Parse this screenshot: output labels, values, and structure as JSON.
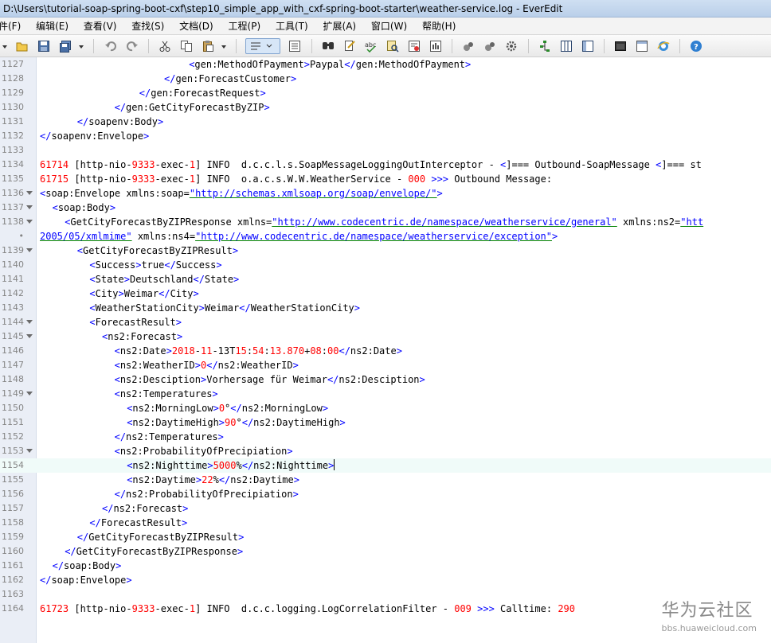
{
  "window": {
    "title": "D:\\Users\\tutorial-soap-spring-boot-cxf\\step10_simple_app_with_cxf-spring-boot-starter\\weather-service.log - EverEdit"
  },
  "menu": [
    "件(F)",
    "编辑(E)",
    "查看(V)",
    "查找(S)",
    "文档(D)",
    "工程(P)",
    "工具(T)",
    "扩展(A)",
    "窗口(W)",
    "帮助(H)"
  ],
  "toolbar": {
    "icons": [
      "open-icon",
      "save-icon",
      "save-all-icon",
      "dropdown-icon",
      "undo-icon",
      "redo-icon",
      "cut-icon",
      "copy-icon",
      "paste-icon",
      "dropdown-icon",
      "word-wrap-icon",
      "indent-icon",
      "find-icon",
      "replace-icon",
      "spell-check-icon",
      "find-in-files-icon",
      "mark-icon",
      "macro-record-icon",
      "macro-play-icon",
      "settings-icon",
      "tree-icon",
      "column-icon",
      "split-icon",
      "terminal-icon",
      "browser-icon",
      "ie-icon",
      "help-icon"
    ]
  },
  "editor": {
    "current_line": "1154",
    "lines": [
      {
        "n": "1127",
        "fold": false,
        "indent": 12,
        "parts": [
          [
            "tag",
            "<"
          ],
          [
            "name",
            "gen:MethodOfPayment"
          ],
          [
            "tag",
            ">"
          ],
          [
            "plain",
            "Paypal"
          ],
          [
            "tag",
            "</"
          ],
          [
            "name",
            "gen:MethodOfPayment"
          ],
          [
            "tag",
            ">"
          ]
        ]
      },
      {
        "n": "1128",
        "fold": false,
        "indent": 10,
        "parts": [
          [
            "tag",
            "</"
          ],
          [
            "name",
            "gen:ForecastCustomer"
          ],
          [
            "tag",
            ">"
          ]
        ]
      },
      {
        "n": "1129",
        "fold": false,
        "indent": 8,
        "parts": [
          [
            "tag",
            "</"
          ],
          [
            "name",
            "gen:ForecastRequest"
          ],
          [
            "tag",
            ">"
          ]
        ]
      },
      {
        "n": "1130",
        "fold": false,
        "indent": 6,
        "parts": [
          [
            "tag",
            "</"
          ],
          [
            "name",
            "gen:GetCityForecastByZIP"
          ],
          [
            "tag",
            ">"
          ]
        ]
      },
      {
        "n": "1131",
        "fold": false,
        "indent": 3,
        "parts": [
          [
            "tag",
            "</"
          ],
          [
            "name",
            "soapenv:Body"
          ],
          [
            "tag",
            ">"
          ]
        ]
      },
      {
        "n": "1132",
        "fold": false,
        "indent": 0,
        "parts": [
          [
            "tag",
            "</"
          ],
          [
            "name",
            "soapenv:Envelope"
          ],
          [
            "tag",
            ">"
          ]
        ]
      },
      {
        "n": "1133",
        "fold": false,
        "indent": 0,
        "parts": []
      },
      {
        "n": "1134",
        "fold": false,
        "indent": 0,
        "parts": [
          [
            "red",
            "61714"
          ],
          [
            "plain",
            " [http-nio-"
          ],
          [
            "red",
            "9333"
          ],
          [
            "plain",
            "-exec-"
          ],
          [
            "red",
            "1"
          ],
          [
            "plain",
            "] INFO  d.c.c.l.s.SoapMessageLoggingOutInterceptor - "
          ],
          [
            "tag",
            "<"
          ],
          [
            "plain",
            "]=== Outbound-SoapMessage "
          ],
          [
            "tag",
            "<"
          ],
          [
            "plain",
            "]=== st"
          ]
        ]
      },
      {
        "n": "1135",
        "fold": false,
        "indent": 0,
        "parts": [
          [
            "red",
            "61715"
          ],
          [
            "plain",
            " [http-nio-"
          ],
          [
            "red",
            "9333"
          ],
          [
            "plain",
            "-exec-"
          ],
          [
            "red",
            "1"
          ],
          [
            "plain",
            "] INFO  o.a.c.s.W.W.WeatherService - "
          ],
          [
            "red",
            "000"
          ],
          [
            "plain",
            " "
          ],
          [
            "tag",
            ">>>"
          ],
          [
            "plain",
            " Outbound Message:"
          ]
        ]
      },
      {
        "n": "1136",
        "fold": true,
        "indent": 0,
        "parts": [
          [
            "tag",
            "<"
          ],
          [
            "name",
            "soap:Envelope xmlns:soap="
          ],
          [
            "str",
            "\"http://schemas.xmlsoap.org/soap/envelope/\""
          ],
          [
            "tag",
            ">"
          ]
        ]
      },
      {
        "n": "1137",
        "fold": true,
        "indent": 1,
        "parts": [
          [
            "tag",
            "<"
          ],
          [
            "name",
            "soap:Body"
          ],
          [
            "tag",
            ">"
          ]
        ]
      },
      {
        "n": "1138",
        "fold": true,
        "indent": 2,
        "parts": [
          [
            "tag",
            "<"
          ],
          [
            "name",
            "GetCityForecastByZIPResponse xmlns="
          ],
          [
            "str",
            "\"http://www.codecentric.de/namespace/weatherservice/general\""
          ],
          [
            "plain",
            " xmlns:ns2="
          ],
          [
            "str",
            "\"htt"
          ]
        ]
      },
      {
        "n": "•",
        "fold": false,
        "indent": 0,
        "parts": [
          [
            "str",
            "2005/05/xmlmime\""
          ],
          [
            "plain",
            " xmlns:ns4="
          ],
          [
            "str",
            "\"http://www.codecentric.de/namespace/weatherservice/exception\""
          ],
          [
            "tag",
            ">"
          ]
        ]
      },
      {
        "n": "1139",
        "fold": true,
        "indent": 3,
        "parts": [
          [
            "tag",
            "<"
          ],
          [
            "name",
            "GetCityForecastByZIPResult"
          ],
          [
            "tag",
            ">"
          ]
        ]
      },
      {
        "n": "1140",
        "fold": false,
        "indent": 4,
        "parts": [
          [
            "tag",
            "<"
          ],
          [
            "name",
            "Success"
          ],
          [
            "tag",
            ">"
          ],
          [
            "plain",
            "true"
          ],
          [
            "tag",
            "</"
          ],
          [
            "name",
            "Success"
          ],
          [
            "tag",
            ">"
          ]
        ]
      },
      {
        "n": "1141",
        "fold": false,
        "indent": 4,
        "parts": [
          [
            "tag",
            "<"
          ],
          [
            "name",
            "State"
          ],
          [
            "tag",
            ">"
          ],
          [
            "plain",
            "Deutschland"
          ],
          [
            "tag",
            "</"
          ],
          [
            "name",
            "State"
          ],
          [
            "tag",
            ">"
          ]
        ]
      },
      {
        "n": "1142",
        "fold": false,
        "indent": 4,
        "parts": [
          [
            "tag",
            "<"
          ],
          [
            "name",
            "City"
          ],
          [
            "tag",
            ">"
          ],
          [
            "plain",
            "Weimar"
          ],
          [
            "tag",
            "</"
          ],
          [
            "name",
            "City"
          ],
          [
            "tag",
            ">"
          ]
        ]
      },
      {
        "n": "1143",
        "fold": false,
        "indent": 4,
        "parts": [
          [
            "tag",
            "<"
          ],
          [
            "name",
            "WeatherStationCity"
          ],
          [
            "tag",
            ">"
          ],
          [
            "plain",
            "Weimar"
          ],
          [
            "tag",
            "</"
          ],
          [
            "name",
            "WeatherStationCity"
          ],
          [
            "tag",
            ">"
          ]
        ]
      },
      {
        "n": "1144",
        "fold": true,
        "indent": 4,
        "parts": [
          [
            "tag",
            "<"
          ],
          [
            "name",
            "ForecastResult"
          ],
          [
            "tag",
            ">"
          ]
        ]
      },
      {
        "n": "1145",
        "fold": true,
        "indent": 5,
        "parts": [
          [
            "tag",
            "<"
          ],
          [
            "name",
            "ns2:Forecast"
          ],
          [
            "tag",
            ">"
          ]
        ]
      },
      {
        "n": "1146",
        "fold": false,
        "indent": 6,
        "parts": [
          [
            "tag",
            "<"
          ],
          [
            "name",
            "ns2:Date"
          ],
          [
            "tag",
            ">"
          ],
          [
            "red",
            "2018"
          ],
          [
            "plain",
            "-"
          ],
          [
            "red",
            "11"
          ],
          [
            "plain",
            "-13T"
          ],
          [
            "red",
            "15"
          ],
          [
            "plain",
            ":"
          ],
          [
            "red",
            "54"
          ],
          [
            "plain",
            ":"
          ],
          [
            "red",
            "13.870"
          ],
          [
            "plain",
            "+"
          ],
          [
            "red",
            "08"
          ],
          [
            "plain",
            ":"
          ],
          [
            "red",
            "00"
          ],
          [
            "tag",
            "</"
          ],
          [
            "name",
            "ns2:Date"
          ],
          [
            "tag",
            ">"
          ]
        ]
      },
      {
        "n": "1147",
        "fold": false,
        "indent": 6,
        "parts": [
          [
            "tag",
            "<"
          ],
          [
            "name",
            "ns2:WeatherID"
          ],
          [
            "tag",
            ">"
          ],
          [
            "red",
            "0"
          ],
          [
            "tag",
            "</"
          ],
          [
            "name",
            "ns2:WeatherID"
          ],
          [
            "tag",
            ">"
          ]
        ]
      },
      {
        "n": "1148",
        "fold": false,
        "indent": 6,
        "parts": [
          [
            "tag",
            "<"
          ],
          [
            "name",
            "ns2:Desciption"
          ],
          [
            "tag",
            ">"
          ],
          [
            "plain",
            "Vorhersage für Weimar"
          ],
          [
            "tag",
            "</"
          ],
          [
            "name",
            "ns2:Desciption"
          ],
          [
            "tag",
            ">"
          ]
        ]
      },
      {
        "n": "1149",
        "fold": true,
        "indent": 6,
        "parts": [
          [
            "tag",
            "<"
          ],
          [
            "name",
            "ns2:Temperatures"
          ],
          [
            "tag",
            ">"
          ]
        ]
      },
      {
        "n": "1150",
        "fold": false,
        "indent": 7,
        "parts": [
          [
            "tag",
            "<"
          ],
          [
            "name",
            "ns2:MorningLow"
          ],
          [
            "tag",
            ">"
          ],
          [
            "red",
            "0"
          ],
          [
            "plain",
            "°"
          ],
          [
            "tag",
            "</"
          ],
          [
            "name",
            "ns2:MorningLow"
          ],
          [
            "tag",
            ">"
          ]
        ]
      },
      {
        "n": "1151",
        "fold": false,
        "indent": 7,
        "parts": [
          [
            "tag",
            "<"
          ],
          [
            "name",
            "ns2:DaytimeHigh"
          ],
          [
            "tag",
            ">"
          ],
          [
            "red",
            "90"
          ],
          [
            "plain",
            "°"
          ],
          [
            "tag",
            "</"
          ],
          [
            "name",
            "ns2:DaytimeHigh"
          ],
          [
            "tag",
            ">"
          ]
        ]
      },
      {
        "n": "1152",
        "fold": false,
        "indent": 6,
        "parts": [
          [
            "tag",
            "</"
          ],
          [
            "name",
            "ns2:Temperatures"
          ],
          [
            "tag",
            ">"
          ]
        ]
      },
      {
        "n": "1153",
        "fold": true,
        "indent": 6,
        "parts": [
          [
            "tag",
            "<"
          ],
          [
            "name",
            "ns2:ProbabilityOfPrecipiation"
          ],
          [
            "tag",
            ">"
          ]
        ]
      },
      {
        "n": "1154",
        "fold": false,
        "indent": 7,
        "parts": [
          [
            "tag",
            "<"
          ],
          [
            "name",
            "ns2:Nighttime"
          ],
          [
            "tag",
            ">"
          ],
          [
            "red",
            "5000"
          ],
          [
            "plain",
            "%"
          ],
          [
            "tag",
            "</"
          ],
          [
            "name",
            "ns2:Nighttime"
          ],
          [
            "tag",
            ">"
          ]
        ]
      },
      {
        "n": "1155",
        "fold": false,
        "indent": 7,
        "parts": [
          [
            "tag",
            "<"
          ],
          [
            "name",
            "ns2:Daytime"
          ],
          [
            "tag",
            ">"
          ],
          [
            "red",
            "22"
          ],
          [
            "plain",
            "%"
          ],
          [
            "tag",
            "</"
          ],
          [
            "name",
            "ns2:Daytime"
          ],
          [
            "tag",
            ">"
          ]
        ]
      },
      {
        "n": "1156",
        "fold": false,
        "indent": 6,
        "parts": [
          [
            "tag",
            "</"
          ],
          [
            "name",
            "ns2:ProbabilityOfPrecipiation"
          ],
          [
            "tag",
            ">"
          ]
        ]
      },
      {
        "n": "1157",
        "fold": false,
        "indent": 5,
        "parts": [
          [
            "tag",
            "</"
          ],
          [
            "name",
            "ns2:Forecast"
          ],
          [
            "tag",
            ">"
          ]
        ]
      },
      {
        "n": "1158",
        "fold": false,
        "indent": 4,
        "parts": [
          [
            "tag",
            "</"
          ],
          [
            "name",
            "ForecastResult"
          ],
          [
            "tag",
            ">"
          ]
        ]
      },
      {
        "n": "1159",
        "fold": false,
        "indent": 3,
        "parts": [
          [
            "tag",
            "</"
          ],
          [
            "name",
            "GetCityForecastByZIPResult"
          ],
          [
            "tag",
            ">"
          ]
        ]
      },
      {
        "n": "1160",
        "fold": false,
        "indent": 2,
        "parts": [
          [
            "tag",
            "</"
          ],
          [
            "name",
            "GetCityForecastByZIPResponse"
          ],
          [
            "tag",
            ">"
          ]
        ]
      },
      {
        "n": "1161",
        "fold": false,
        "indent": 1,
        "parts": [
          [
            "tag",
            "</"
          ],
          [
            "name",
            "soap:Body"
          ],
          [
            "tag",
            ">"
          ]
        ]
      },
      {
        "n": "1162",
        "fold": false,
        "indent": 0,
        "parts": [
          [
            "tag",
            "</"
          ],
          [
            "name",
            "soap:Envelope"
          ],
          [
            "tag",
            ">"
          ]
        ]
      },
      {
        "n": "1163",
        "fold": false,
        "indent": 0,
        "parts": []
      },
      {
        "n": "1164",
        "fold": false,
        "indent": 0,
        "parts": [
          [
            "red",
            "61723"
          ],
          [
            "plain",
            " [http-nio-"
          ],
          [
            "red",
            "9333"
          ],
          [
            "plain",
            "-exec-"
          ],
          [
            "red",
            "1"
          ],
          [
            "plain",
            "] INFO  d.c.c.logging.LogCorrelationFilter - "
          ],
          [
            "red",
            "009"
          ],
          [
            "plain",
            " "
          ],
          [
            "tag",
            ">>>"
          ],
          [
            "plain",
            " Calltime: "
          ],
          [
            "red",
            "290"
          ]
        ]
      }
    ]
  },
  "watermark": {
    "logo": "华为云社区",
    "url": "bbs.huaweicloud.com"
  },
  "colors": {
    "tag": "#0000ff",
    "number": "#ff0000",
    "gutter": "#eaeef6",
    "current_line": "#f0fbf9"
  }
}
